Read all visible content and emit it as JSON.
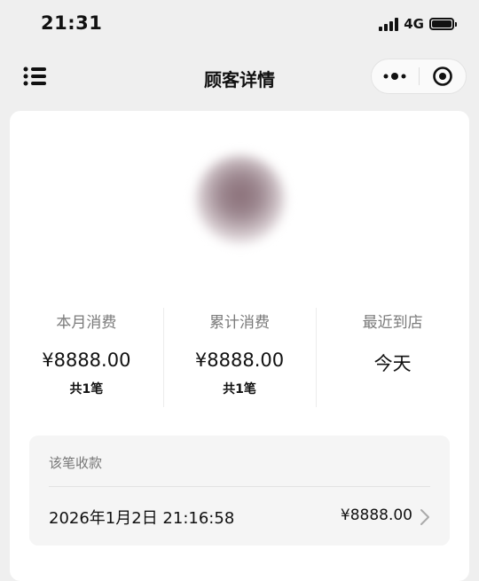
{
  "status_bar": {
    "time": "21:31",
    "network": "4G"
  },
  "nav": {
    "title": "顾客详情",
    "left_icon": "list-icon",
    "right_icons": [
      "more-icon",
      "target-close-icon"
    ]
  },
  "customer": {
    "avatar_icon": "avatar"
  },
  "stats": [
    {
      "label": "本月消费",
      "value": "¥8888.00",
      "count": "共1笔"
    },
    {
      "label": "累计消费",
      "value": "¥8888.00",
      "count": "共1笔"
    },
    {
      "label": "最近到店",
      "value": "今天",
      "count": ""
    }
  ],
  "record": {
    "title": "该笔收款",
    "time": "2026年1月2日 21:16:58",
    "amount": "¥8888.00"
  }
}
